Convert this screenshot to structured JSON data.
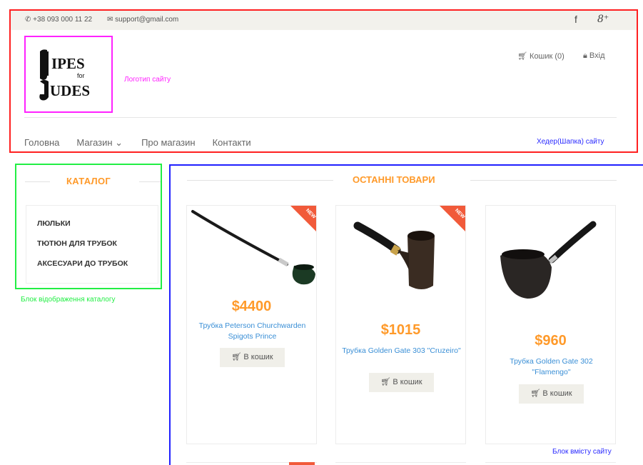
{
  "topbar": {
    "phone": "+38 093 000 11 22",
    "email": "support@gmail.com",
    "social": [
      "f",
      "8⁺"
    ]
  },
  "header": {
    "logo_caption": "Логотип сайту",
    "cart_label": "Кошик (0)",
    "login_label": "Вхід",
    "menu": [
      "Головна",
      "Магазин ⌄",
      "Про магазин",
      "Контакти"
    ],
    "caption": "Хедер(Шапка) сайту",
    "logo_text": {
      "line1": "IPES",
      "for": "for",
      "line2": "UDES"
    }
  },
  "catalog": {
    "title": "КАТАЛОГ",
    "items": [
      "ЛЮЛЬКИ",
      "ТЮТЮН ДЛЯ ТРУБОК",
      "АКСЕСУАРИ ДО ТРУБОК"
    ],
    "caption": "Блок відображення каталогу"
  },
  "content": {
    "title": "ОСТАННІ ТОВАРИ",
    "products": [
      {
        "price": "$4400",
        "name": "Трубка Peterson Churchwarden Spigots Prince",
        "badge": "NEW",
        "button": "В кошик"
      },
      {
        "price": "$1015",
        "name": "Трубка Golden Gate 303 \"Cruzeiro\"",
        "badge": "NEW",
        "button": "В кошик"
      },
      {
        "price": "$960",
        "name": "Трубка Golden Gate 302 \"Flamengo\"",
        "badge": "",
        "button": "В кошик"
      }
    ],
    "caption": "Блок вмісту сайту"
  },
  "colors": {
    "accent": "#ff9a2a",
    "link": "#3a8fd6",
    "badge": "#f15a3a"
  }
}
